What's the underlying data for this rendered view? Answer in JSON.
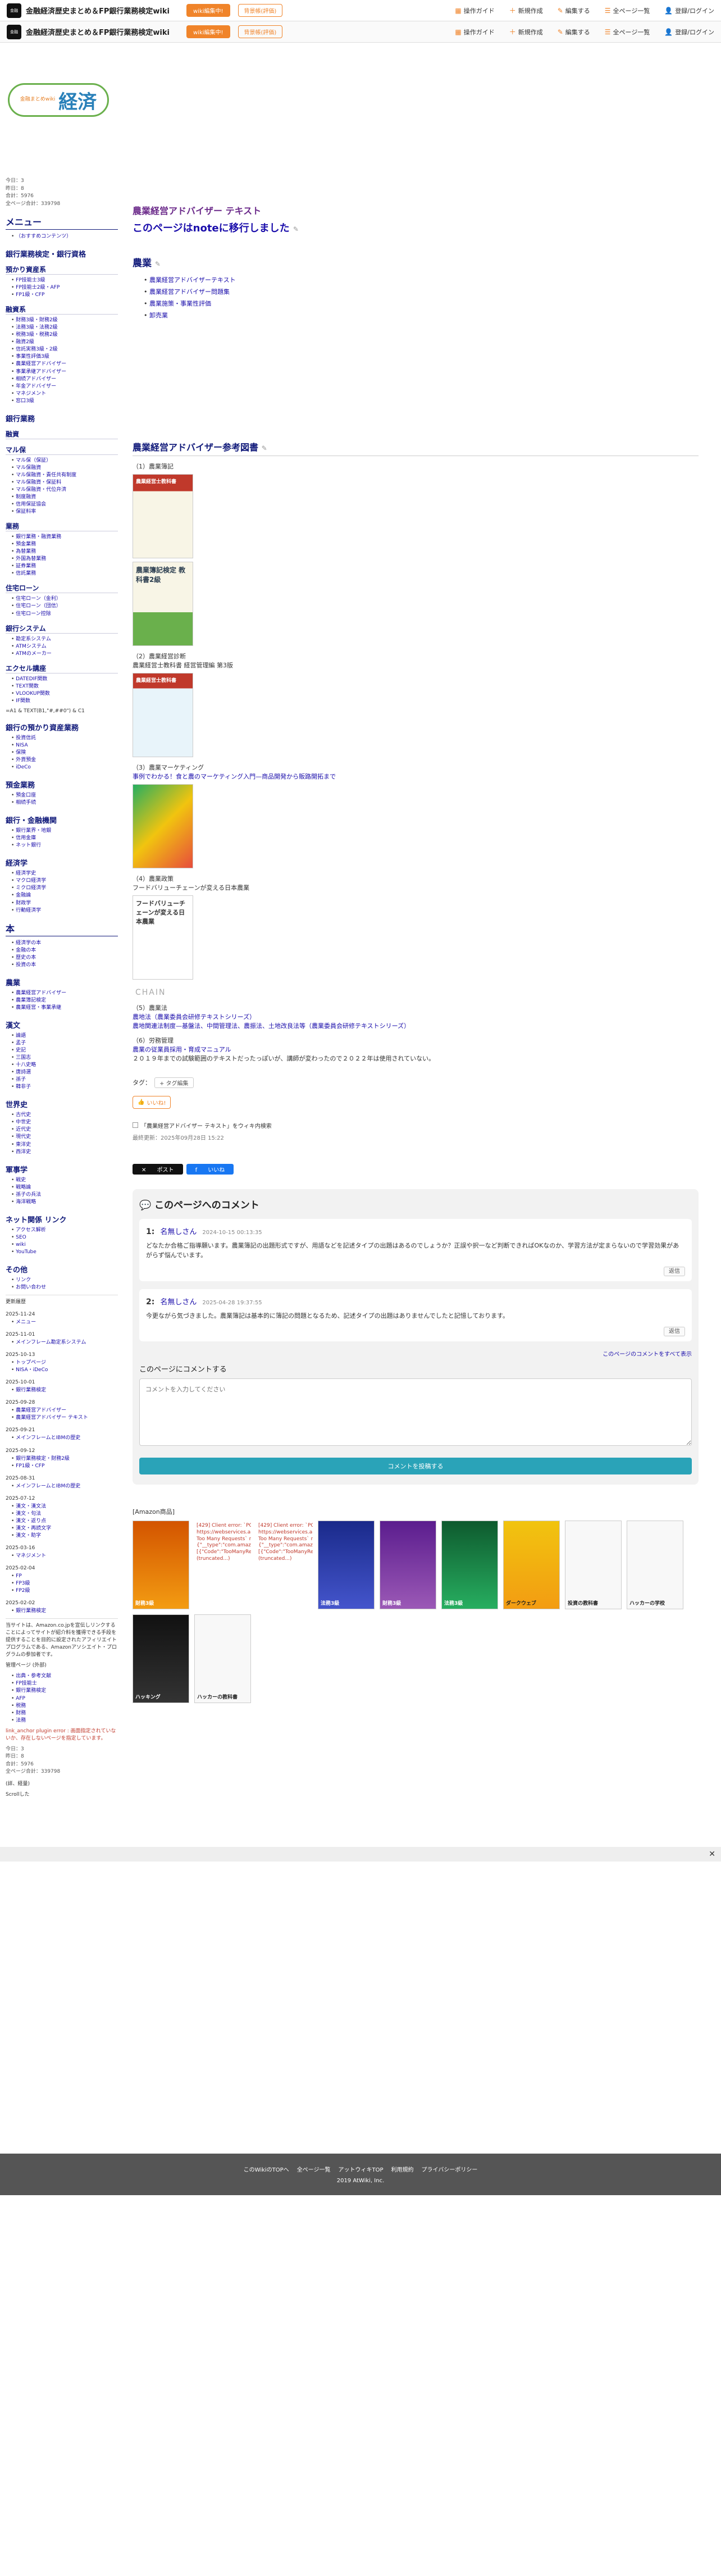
{
  "header": {
    "logo_text": "金融",
    "site_title": "金融経済歴史まとめ＆FP銀行業務検定wiki",
    "btn_edit_wiki": "wiki編集中!",
    "btn_bg": "背景帳(評価)",
    "menu": [
      "操作ガイド",
      "新規作成",
      "編集する",
      "全ページ一覧",
      "登録/ログイン"
    ]
  },
  "logo": {
    "small": "金融まとめwiki",
    "big": "経済"
  },
  "sidebar": {
    "counter": [
      "今日：3",
      "昨日：8",
      "合計：5976",
      "全ページ合計：339798"
    ],
    "menu_h": "メニュー",
    "menu_top": "（おすすめコンテンツ）",
    "h_bank": "銀行業務検定・銀行資格",
    "h_fp": "預かり資産系",
    "fp_items": [
      "FP技能士3級",
      "FP技能士2級・AFP",
      "FP1級・CFP"
    ],
    "h_loan": "融資系",
    "loan_items": [
      "財務3級・財務2級",
      "法務3級・法務2級",
      "税務3級・税務2級",
      "融資2級",
      "信託実務3級・2級",
      "事業性評価3級",
      "農業経営アドバイザー",
      "事業承継アドバイザー",
      "相続アドバイザー",
      "年金アドバイザー",
      "マネジメント",
      "窓口3級"
    ],
    "h_bank2": "銀行業務",
    "h_savings": "融資",
    "h_mahou": "マル保",
    "mahou_items": [
      "マル保（保証）",
      "マル保融資",
      "マル保融資・責任共有制度",
      "マル保融資・保証料",
      "マル保融資・代位弁済",
      "制度融資",
      "信用保証協会",
      "保証料率"
    ],
    "h_gyomu": "業務",
    "gyomu_items": [
      "銀行業務・融資業務",
      "預金業務",
      "為替業務",
      "外国為替業務",
      "証券業務",
      "信託業務"
    ],
    "h_jutaku": "住宅ローン",
    "jutaku_items": [
      "住宅ローン（金利）",
      "住宅ローン（団信）",
      "住宅ローン控除"
    ],
    "h_system": "銀行システム",
    "system_items": [
      "勘定系システム",
      "ATMシステム",
      "ATMのメーカー"
    ],
    "h_excel": "エクセル講座",
    "excel_items": [
      "DATEDIF関数",
      "TEXT関数",
      "VLOOKUP関数",
      "IF関数"
    ],
    "excel_note": "=A1 & TEXT(B1,\"#,##0\") & C1",
    "h_azukari": "銀行の預かり資産業務",
    "azukari_items": [
      "投資信託",
      "NISA",
      "保険",
      "外貨預金",
      "iDeCo"
    ],
    "h_yokin": "預金業務",
    "yokin_items": [
      "預金口座",
      "相続手続"
    ],
    "h_kinyu": "銀行・金融機関",
    "kinyu_items": [
      "銀行業界・地銀",
      "信用金庫",
      "ネット銀行"
    ],
    "h_keizai": "経済学",
    "keizai_items": [
      "経済学史",
      "マクロ経済学",
      "ミクロ経済学",
      "金融論",
      "財政学",
      "行動経済学"
    ],
    "h_hon": "本",
    "hon_items": [
      "経済学の本",
      "金融の本",
      "歴史の本",
      "投資の本"
    ],
    "h_nogyo": "農業",
    "nogyo_items": [
      "農業経営アドバイザー",
      "農業簿記検定",
      "農業経営・事業承継"
    ],
    "h_kanbun": "漢文",
    "kanbun_items": [
      "論語",
      "孟子",
      "史記",
      "三国志",
      "十八史略",
      "唐詩選",
      "孫子",
      "韓非子"
    ],
    "h_sekai": "世界史",
    "sekai_items": [
      "古代史",
      "中世史",
      "近代史",
      "現代史",
      "東洋史",
      "西洋史"
    ],
    "h_gunji": "軍事学",
    "gunji_items": [
      "戦史",
      "戦略論",
      "孫子の兵法",
      "海洋戦略"
    ],
    "h_net": "ネット関係 リンク",
    "net_items": [
      "アクセス解析",
      "SEO",
      "wiki",
      "YouTube"
    ],
    "h_sonota": "その他",
    "sonota_items": [
      "リンク",
      "お問い合わせ"
    ],
    "update_h": "更新履歴",
    "updates": [
      {
        "date": "2025-11-24",
        "items": [
          "メニュー"
        ]
      },
      {
        "date": "2025-11-01",
        "items": [
          "メインフレーム勘定系システム"
        ]
      },
      {
        "date": "2025-10-13",
        "items": [
          "トップページ",
          "NISA・iDeCo"
        ]
      },
      {
        "date": "2025-10-01",
        "items": [
          "銀行業務検定"
        ]
      },
      {
        "date": "2025-09-28",
        "items": [
          "農業経営アドバイザー",
          "農業経営アドバイザー テキスト"
        ]
      },
      {
        "date": "2025-09-21",
        "items": [
          "メインフレームとIBMの歴史"
        ]
      },
      {
        "date": "2025-09-12",
        "items": [
          "銀行業務検定・財務2級",
          "FP1級・CFP"
        ]
      },
      {
        "date": "2025-08-31",
        "items": [
          "メインフレームとIBMの歴史"
        ]
      },
      {
        "date": "2025-07-12",
        "items": [
          "漢文・漢文法",
          "漢文・句法",
          "漢文・返り点",
          "漢文・再読文字",
          "漢文・助字"
        ]
      },
      {
        "date": "2025-03-16",
        "items": [
          "マネジメント"
        ]
      },
      {
        "date": "2025-02-04",
        "items": [
          "FP",
          "FP3級",
          "FP2級"
        ]
      },
      {
        "date": "2025-02-02",
        "items": [
          "銀行業務検定"
        ]
      }
    ],
    "amazon_note": "当サイトは、Amazon.co.jpを宣伝しリンクすることによってサイトが紹介料を獲得できる手段を提供することを目的に設定されたアフィリエイトプログラムである、Amazonアソシエイト・プログラムの参加者です。",
    "admin_h": "管理ページ",
    "admin_sub": "(外部)",
    "admin_items": [
      "出典・参考文献",
      "FP技能士",
      "銀行業務検定",
      "AFP",
      "税務",
      "財務",
      "法務"
    ],
    "error_note": "link_anchor plugin error : 画面指定されていないか、存在しないページを指定しています。",
    "counter2": [
      "今日：3",
      "昨日：8",
      "合計：5976",
      "全ページ合計：339798"
    ],
    "edit_note": "(詳、経量)",
    "scroll": "Scrollした"
  },
  "main": {
    "title": "農業経営アドバイザー テキスト",
    "moved": "このページはnoteに移行しました",
    "nogyo_h": "農業",
    "nogyo_links": [
      "農業経営アドバイザーテキスト",
      "農業経営アドバイザー問題集",
      "農業施策・事業性評価",
      "卸売業"
    ],
    "ref_h": "農業経営アドバイザー参考図書",
    "refs": [
      {
        "num": "（1）農業簿記",
        "link": "",
        "desc": ""
      },
      {
        "num": "（2）農業経営診断",
        "link": "",
        "desc": "農業経営士教科書 経営管理編 第3版"
      },
      {
        "num": "（3）農業マーケティング",
        "link": "事例でわかる！食と農のマーケティング入門—商品開発から販路開拓まで",
        "desc": ""
      },
      {
        "num": "（4）農業政策",
        "link": "",
        "desc": "フードバリューチェーンが変える日本農業"
      },
      {
        "num": "（5）農業法",
        "link": "農地法（農業委員会研修テキストシリーズ）",
        "desc": "農地関連法制度—基盤法、中間管理法、農振法、土地改良法等（農業委員会研修テキストシリーズ）"
      },
      {
        "num": "（6）労務管理",
        "link": "",
        "desc": "農業の従業員採用・育成マニュアル"
      }
    ],
    "ref_note": "２０１９年までの試験範囲のテキストだったっぽいが、講師が変わったので２０２２年は使用されていない。",
    "book_a": "農業経営士教科書",
    "book_b": "農業簿記検定 教科書2級",
    "book_c": "農業経営士教科書",
    "book_d": "",
    "book_e": "フードバリューチェーンが変える日本農業",
    "book_f": "CHAIN",
    "tag_label": "タグ：",
    "tag_chip": "+ タグ編集",
    "like": "いいね!",
    "page_links": "「農業経営アドバイザー テキスト」をウィキ内検索",
    "updated": "最終更新：2025年09月28日 15:22",
    "share_x": "ポスト",
    "share_fb": "いいね",
    "comments_h": "このページへのコメント",
    "comments": [
      {
        "num": "1:",
        "name": "名無しさん",
        "date": "2024-10-15 00:13:35",
        "body": "どなたか合格ご指導願います。農業簿記の出題形式ですが、用語などを記述タイプの出題はあるのでしょうか？正誤や択一など判断できればOKなのか、学習方法が定まらないので学習効果があがらず悩んでいます。"
      },
      {
        "num": "2:",
        "name": "名無しさん",
        "date": "2025-04-28 19:37:55",
        "body": "今更ながら気づきました。農業簿記は基本的に簿記の問題となるため、記述タイプの出題はありませんでしたと記憶しております。"
      }
    ],
    "reply": "返信",
    "all_comments": "このページのコメントをすべて表示",
    "form_h": "このページにコメントする",
    "form_placeholder": "コメントを入力してください",
    "submit": "コメントを投稿する",
    "amazon_h": "[Amazon商品]",
    "amazon_error": "[429] Client error: `POST https://webservices.amazon.co.jp/paapi5/getitems` resulted in a `429 Too Many Requests` response: {\"__type\":\"com.amazon.paapi5#TooManyRequestsException\",\"Errors\":[{\"Code\":\"TooManyRequests\",\"Message\":\"The request was de (truncated...)",
    "amazon_books": [
      "財務3級",
      "法務3級",
      "財務3級",
      "法務3級",
      "ダークウェブ",
      "投資の教科書",
      "ハッカーの学校",
      "ハッキング",
      "ハッカーの教科書"
    ]
  },
  "footer": {
    "links": [
      "このWikiのTOPへ",
      "全ページ一覧",
      "アットウィキTOP",
      "利用規約",
      "プライバシーポリシー"
    ],
    "copy": "2019 AtWiki, Inc."
  },
  "colors": {
    "accent": "#f0842a",
    "heading": "#111a7a",
    "link": "#1a0dab",
    "title": "#6b2a8a",
    "submit": "#2aa3b8"
  }
}
